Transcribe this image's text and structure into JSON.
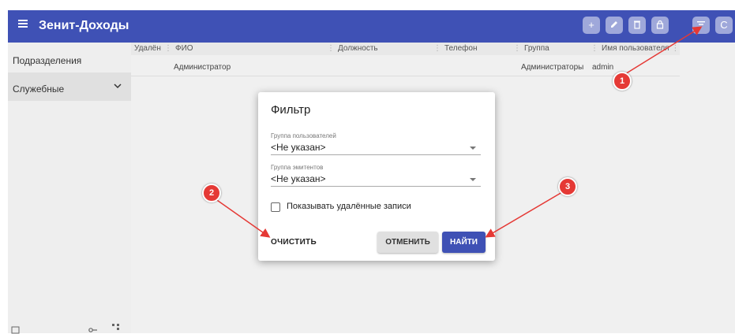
{
  "app": {
    "title": "Зенит-Доходы"
  },
  "colors": {
    "appbar": "#3f51b5",
    "annotation": "#e53935"
  },
  "toolbar": {
    "buttons": [
      {
        "icon": "plus-icon",
        "glyph": "+"
      },
      {
        "icon": "pencil-icon"
      },
      {
        "icon": "trash-icon"
      },
      {
        "icon": "lock-icon"
      },
      {
        "icon": "filter-icon"
      },
      {
        "icon": "refresh-icon",
        "glyph": "C"
      }
    ]
  },
  "sidebar": {
    "items": [
      {
        "label": "Подразделения"
      },
      {
        "label": "Служебные"
      }
    ]
  },
  "table": {
    "columns": [
      "Удалён",
      "ФИО",
      "Должность",
      "Телефон",
      "Группа",
      "Имя пользователя"
    ],
    "rows": [
      {
        "fio": "Администратор",
        "group": "Администраторы",
        "username": "admin"
      }
    ]
  },
  "dialog": {
    "title": "Фильтр",
    "field1": {
      "label": "Группа пользователей",
      "value": "<Не указан>"
    },
    "field2": {
      "label": "Группа эмитентов",
      "value": "<Не указан>"
    },
    "checkbox_label": "Показывать удалённые записи",
    "clear_label": "ОЧИСТИТЬ",
    "cancel_label": "ОТМЕНИТЬ",
    "find_label": "НАЙТИ"
  },
  "annotations": [
    "1",
    "2",
    "3"
  ]
}
